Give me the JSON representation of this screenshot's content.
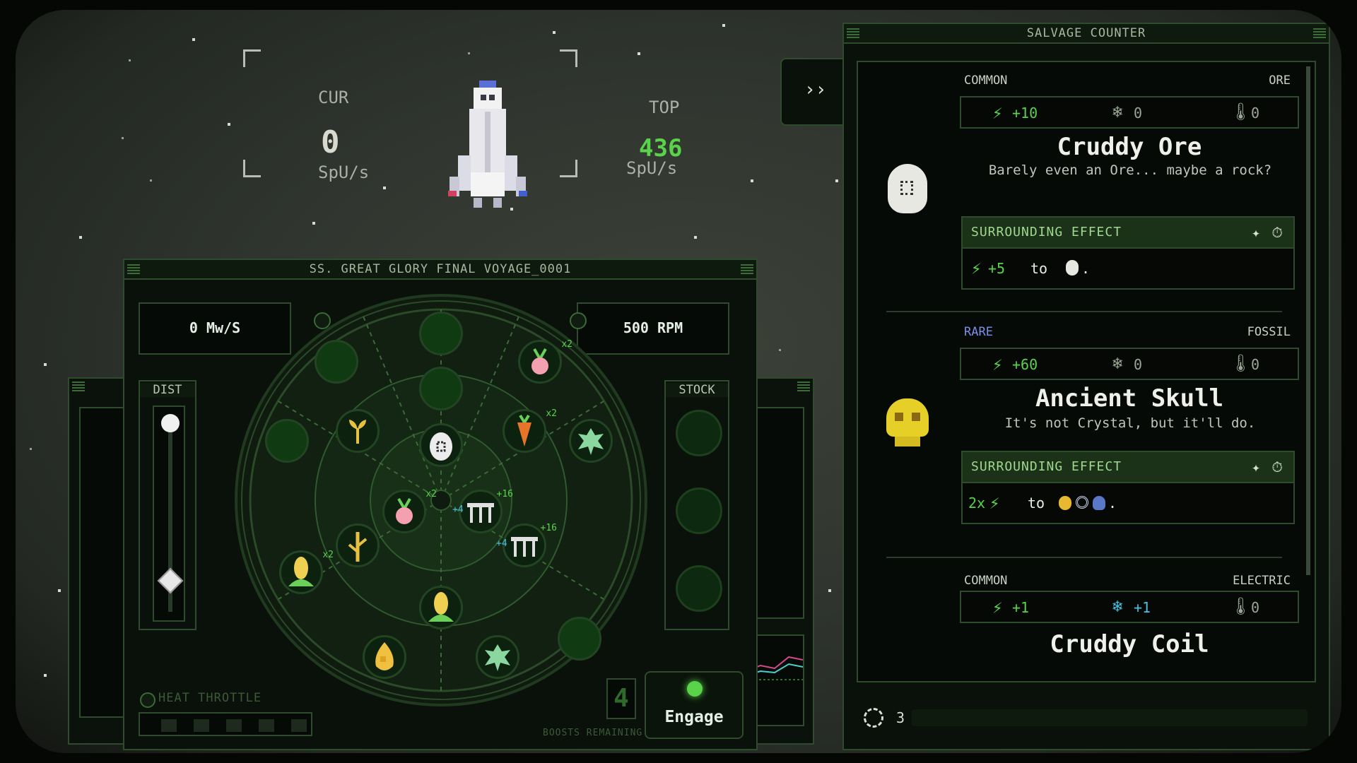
{
  "hud": {
    "cur_label": "CUR",
    "cur_value": "0",
    "cur_unit": "SpU/s",
    "top_label": "TOP",
    "top_value": "436",
    "top_unit": "SpU/s"
  },
  "toggle_panel_label": "››",
  "ship": {
    "title": "SS. GREAT GLORY FINAL VOYAGE_0001",
    "power_readout": "0 Mw/S",
    "rpm_readout": "500 RPM",
    "dist_label": "DIST",
    "stock_label": "STOCK",
    "heat_throttle_label": "HEAT THROTTLE",
    "boosts_count": "4",
    "boosts_label": "BOOSTS REMAINING",
    "engage_label": "Engage",
    "dist_slider_level": 0.15,
    "modules": [
      {
        "name": "radish",
        "badge": "x2"
      },
      {
        "name": "carrot",
        "badge": "x2"
      },
      {
        "name": "radish",
        "badge": "x2"
      },
      {
        "name": "corn",
        "badge": "x2"
      },
      {
        "name": "fence",
        "badge": "+16"
      },
      {
        "name": "fence",
        "badge": "+16"
      }
    ],
    "fence_sub_badge": "+4"
  },
  "salvage": {
    "title": "SALVAGE COUNTER",
    "items": [
      {
        "rarity": "COMMON",
        "type": "ORE",
        "power": "+10",
        "cooling": "0",
        "heat": "0",
        "name": "Cruddy Ore",
        "desc": "Barely even an Ore... maybe a rock?",
        "effect_label": "SURROUNDING EFFECT",
        "effect_value": "+5",
        "effect_to": "to",
        "effect_end": "."
      },
      {
        "rarity": "RARE",
        "type": "FOSSIL",
        "power": "+60",
        "cooling": "0",
        "heat": "0",
        "name": "Ancient Skull",
        "desc": "It's not Crystal, but it'll do.",
        "effect_label": "SURROUNDING EFFECT",
        "effect_value": "2x",
        "effect_to": "to",
        "effect_end": "."
      },
      {
        "rarity": "COMMON",
        "type": "ELECTRIC",
        "power": "+1",
        "cooling": "+1",
        "heat": "0",
        "name": "Cruddy Coil"
      }
    ],
    "refresh_count": "3"
  },
  "colors": {
    "accent_green": "#59d34a",
    "rare_blue": "#7b8fe8",
    "panel_bg": "#0a100a",
    "panel_border": "#2f4a2d"
  }
}
